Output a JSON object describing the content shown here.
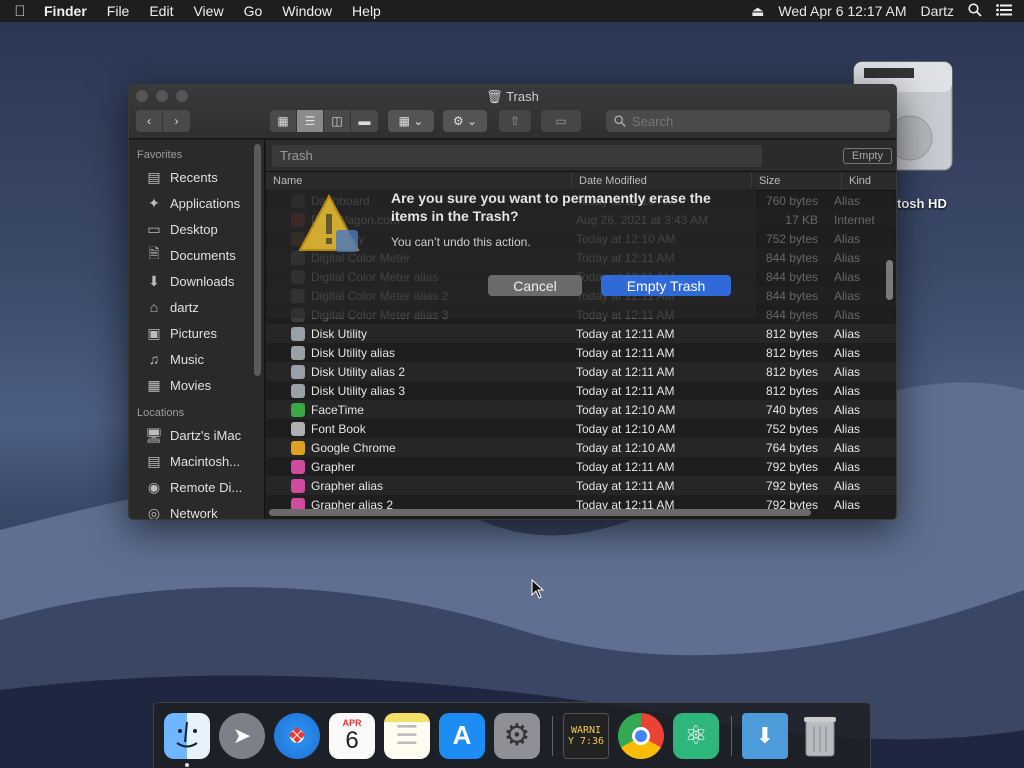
{
  "menubar": {
    "app": "Finder",
    "items": [
      "File",
      "Edit",
      "View",
      "Go",
      "Window",
      "Help"
    ],
    "datetime": "Wed Apr 6  12:17 AM",
    "user": "Dartz"
  },
  "desktop": {
    "disk_label": "tosh HD"
  },
  "window": {
    "title": "Trash",
    "search_placeholder": "Search",
    "path_title": "Trash",
    "empty_button": "Empty"
  },
  "sidebar": {
    "favorites_header": "Favorites",
    "favorites": [
      "Recents",
      "Applications",
      "Desktop",
      "Documents",
      "Downloads",
      "dartz",
      "Pictures",
      "Music",
      "Movies"
    ],
    "locations_header": "Locations",
    "locations": [
      "Dartz's iMac",
      "Macintosh...",
      "Remote Di...",
      "Network"
    ]
  },
  "columns": {
    "name": "Name",
    "date": "Date Modified",
    "size": "Size",
    "kind": "Kind"
  },
  "files": [
    {
      "name": "Dashboard",
      "date": "Today at 12:10 AM",
      "size": "760 bytes",
      "kind": "Alias",
      "color": "#555555"
    },
    {
      "name": "DataWagon.com",
      "date": "Aug 26, 2021 at 3:43 AM",
      "size": "17 KB",
      "kind": "Internet",
      "color": "#c04040"
    },
    {
      "name": "Dictionary",
      "date": "Today at 12:10 AM",
      "size": "752 bytes",
      "kind": "Alias",
      "color": "#8b5a2b"
    },
    {
      "name": "Digital Color Meter",
      "date": "Today at 12:11 AM",
      "size": "844 bytes",
      "kind": "Alias",
      "color": "#777777"
    },
    {
      "name": "Digital Color Meter alias",
      "date": "Today at 12:11 AM",
      "size": "844 bytes",
      "kind": "Alias",
      "color": "#777777"
    },
    {
      "name": "Digital Color Meter alias 2",
      "date": "Today at 12:11 AM",
      "size": "844 bytes",
      "kind": "Alias",
      "color": "#777777"
    },
    {
      "name": "Digital Color Meter alias 3",
      "date": "Today at 12:11 AM",
      "size": "844 bytes",
      "kind": "Alias",
      "color": "#777777"
    },
    {
      "name": "Disk Utility",
      "date": "Today at 12:11 AM",
      "size": "812 bytes",
      "kind": "Alias",
      "color": "#9aa0a8"
    },
    {
      "name": "Disk Utility alias",
      "date": "Today at 12:11 AM",
      "size": "812 bytes",
      "kind": "Alias",
      "color": "#9aa0a8"
    },
    {
      "name": "Disk Utility alias 2",
      "date": "Today at 12:11 AM",
      "size": "812 bytes",
      "kind": "Alias",
      "color": "#9aa0a8"
    },
    {
      "name": "Disk Utility alias 3",
      "date": "Today at 12:11 AM",
      "size": "812 bytes",
      "kind": "Alias",
      "color": "#9aa0a8"
    },
    {
      "name": "FaceTime",
      "date": "Today at 12:10 AM",
      "size": "740 bytes",
      "kind": "Alias",
      "color": "#3aa845"
    },
    {
      "name": "Font Book",
      "date": "Today at 12:10 AM",
      "size": "752 bytes",
      "kind": "Alias",
      "color": "#b0b0b0"
    },
    {
      "name": "Google Chrome",
      "date": "Today at 12:10 AM",
      "size": "764 bytes",
      "kind": "Alias",
      "color": "#e0a020"
    },
    {
      "name": "Grapher",
      "date": "Today at 12:11 AM",
      "size": "792 bytes",
      "kind": "Alias",
      "color": "#d04aa0"
    },
    {
      "name": "Grapher alias",
      "date": "Today at 12:11 AM",
      "size": "792 bytes",
      "kind": "Alias",
      "color": "#d04aa0"
    },
    {
      "name": "Grapher alias 2",
      "date": "Today at 12:11 AM",
      "size": "792 bytes",
      "kind": "Alias",
      "color": "#d04aa0"
    }
  ],
  "dialog": {
    "title": "Are you sure you want to permanently erase the items in the Trash?",
    "message": "You can’t undo this action.",
    "cancel": "Cancel",
    "confirm": "Empty Trash"
  },
  "dock": {
    "calendar_month": "APR",
    "calendar_day": "6",
    "console_line1": "WARNI",
    "console_line2": "Y 7:36"
  }
}
